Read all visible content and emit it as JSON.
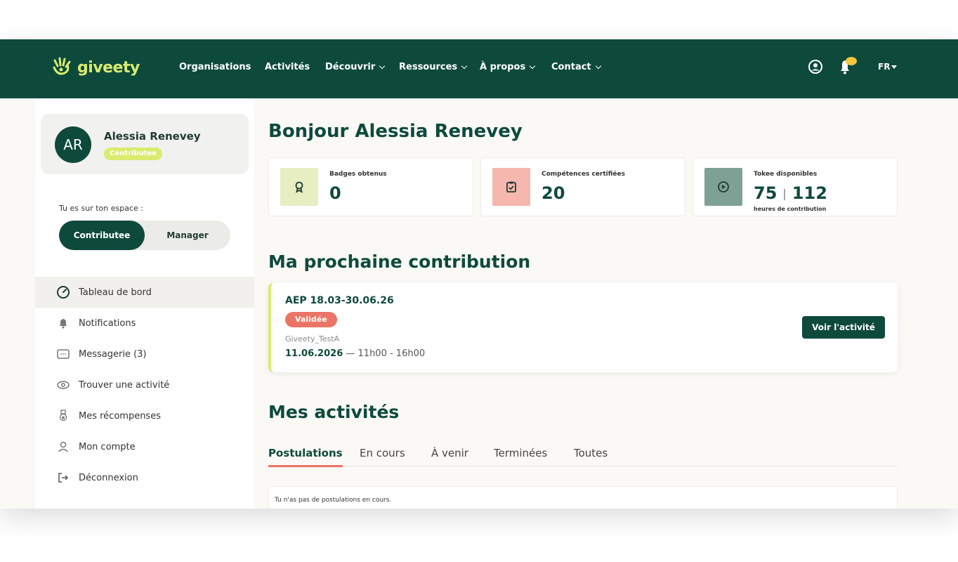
{
  "brand": {
    "name": "giveety"
  },
  "nav": {
    "items": [
      {
        "label": "Organisations",
        "dropdown": false
      },
      {
        "label": "Activités",
        "dropdown": false
      },
      {
        "label": "Découvrir",
        "dropdown": true
      },
      {
        "label": "Ressources",
        "dropdown": true
      },
      {
        "label": "À propos",
        "dropdown": true
      },
      {
        "label": "Contact",
        "dropdown": true
      }
    ],
    "icons": [
      "user-circle-icon",
      "bell-icon"
    ],
    "lang": "FR"
  },
  "sidebar": {
    "profile": {
      "initials": "AR",
      "name": "Alessia Renevey",
      "role": "Contributee"
    },
    "space_label": "Tu es sur ton espace :",
    "toggle": {
      "active": "Contributee",
      "inactive": "Manager"
    },
    "menu": [
      {
        "label": "Tableau de bord",
        "icon": "dashboard-icon",
        "active": true
      },
      {
        "label": "Notifications",
        "icon": "bell-icon",
        "active": false
      },
      {
        "label": "Messagerie (3)",
        "icon": "message-icon",
        "active": false
      },
      {
        "label": "Trouver une activité",
        "icon": "eye-icon",
        "active": false
      },
      {
        "label": "Mes récompenses",
        "icon": "reward-icon",
        "active": false
      },
      {
        "label": "Mon compte",
        "icon": "user-icon",
        "active": false
      },
      {
        "label": "Déconnexion",
        "icon": "logout-icon",
        "active": false
      }
    ]
  },
  "main": {
    "greeting": "Bonjour Alessia Renevey",
    "stats": [
      {
        "label": "Badges obtenus",
        "value": "0",
        "icon": "award-icon",
        "icon_bg": "#e6eec2"
      },
      {
        "label": "Compétences certifiées",
        "value": "20",
        "icon": "clipboard-check-icon",
        "icon_bg": "#f5b7ae"
      },
      {
        "label": "Tokee disponibles",
        "value": "75",
        "value2": "112",
        "sublabel": "heures de contribution",
        "icon": "token-icon",
        "icon_bg": "#7fa195"
      }
    ],
    "next_contribution": {
      "title": "Ma prochaine contribution",
      "activity": "AEP 18.03-30.06.26",
      "status": "Validée",
      "organization": "Giveety_TestA",
      "date": "11.06.2026",
      "time": "— 11h00 - 16h00",
      "button": "Voir l'activité"
    },
    "activities": {
      "title": "Mes activités",
      "tabs": [
        "Postulations",
        "En cours",
        "À venir",
        "Terminées",
        "Toutes"
      ],
      "active_tab": 0,
      "empty_message": "Tu n'as pas de postulations en cours."
    }
  },
  "colors": {
    "primary": "#0e4a3c",
    "accent_lime": "#d9ec6f",
    "accent_coral": "#ea7566"
  }
}
